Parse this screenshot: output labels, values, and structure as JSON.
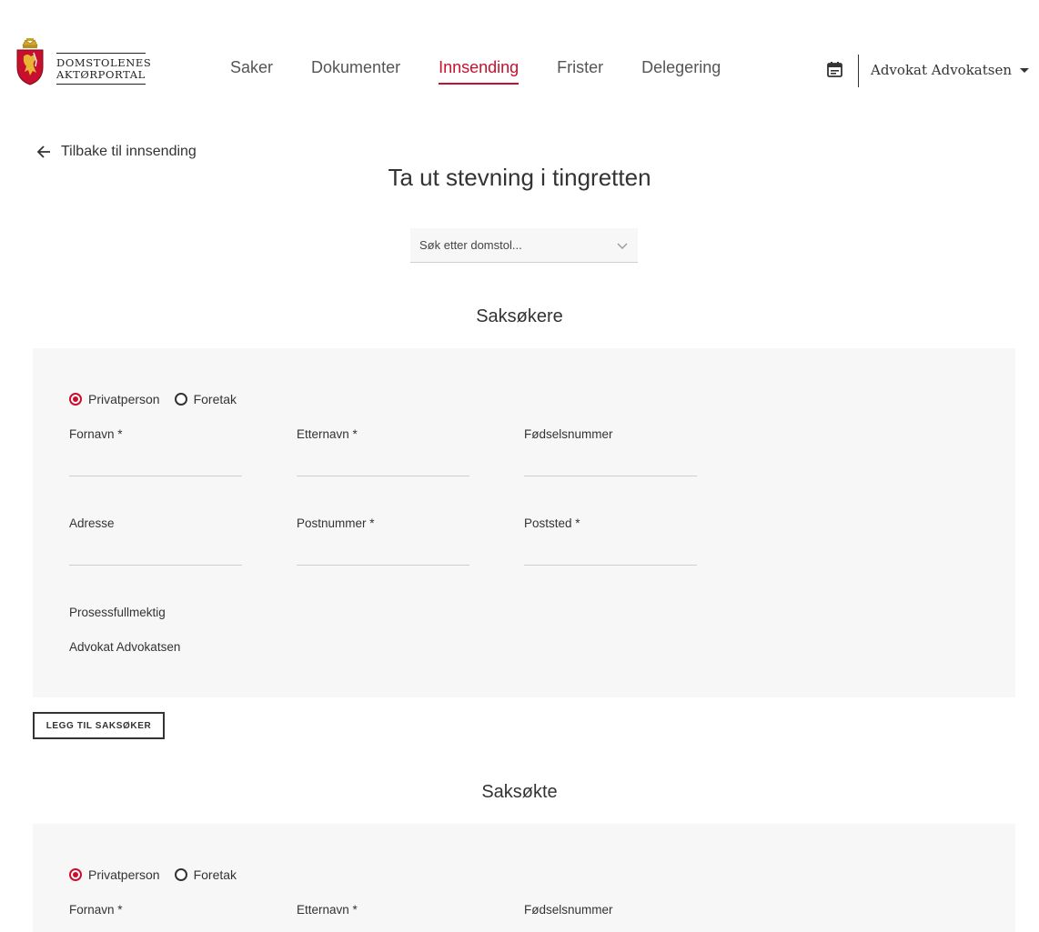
{
  "header": {
    "logo_line1": "DOMSTOLENES",
    "logo_line2": "AKTØRPORTAL",
    "nav": [
      {
        "label": "Saker"
      },
      {
        "label": "Dokumenter"
      },
      {
        "label": "Innsending"
      },
      {
        "label": "Frister"
      },
      {
        "label": "Delegering"
      }
    ],
    "active_nav": "Innsending",
    "user_name": "Advokat Advokatsen"
  },
  "back_link": "Tilbake til innsending",
  "page_title": "Ta ut stevning i tingretten",
  "court_search": {
    "placeholder": "Søk etter domstol..."
  },
  "plaintiffs": {
    "title": "Saksøkere",
    "radio_person": "Privatperson",
    "radio_company": "Foretak",
    "selected": "Privatperson",
    "fields": {
      "first_name": "Fornavn *",
      "last_name": "Etternavn *",
      "ssn": "Fødselsnummer",
      "address": "Adresse",
      "postal_code": "Postnummer *",
      "city": "Poststed *"
    },
    "counsel_label": "Prosessfullmektig",
    "counsel_value": "Advokat Advokatsen",
    "add_button": "LEGG TIL SAKSØKER"
  },
  "defendants": {
    "title": "Saksøkte",
    "radio_person": "Privatperson",
    "radio_company": "Foretak",
    "selected": "Privatperson",
    "fields": {
      "first_name": "Fornavn *",
      "last_name": "Etternavn *",
      "ssn": "Fødselsnummer"
    }
  },
  "colors": {
    "accent": "#c8102e",
    "panel": "#f7f7f7",
    "text": "#333333"
  }
}
